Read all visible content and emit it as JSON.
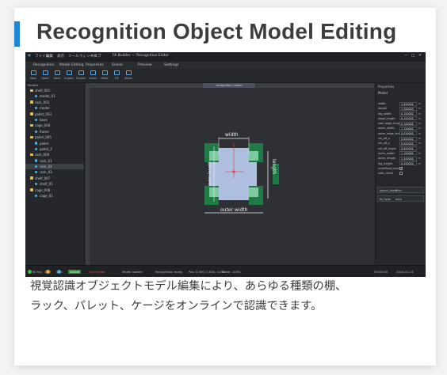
{
  "card": {
    "title": "Recognition Object Model Editing",
    "caption_line1": "視覚認識オブジェクトモデル編集により、あらゆる種類の棚、",
    "caption_line2": "ラック、パレット、ケージをオンラインで認識できます。",
    "accent_color": "#1d84d6"
  },
  "app": {
    "title_menus": [
      "ファイル",
      "編集",
      "表示",
      "ツール",
      "ウィンドウ",
      "ヘルプ"
    ],
    "window_title": "FA Builder — Recognition Editor",
    "window_controls": [
      "minimize-icon",
      "maximize-icon",
      "close-icon"
    ],
    "tabs": [
      "Recognition",
      "Model Editing",
      "Properties",
      "Scene",
      "Preview",
      "Settings"
    ],
    "toolbar": [
      "New",
      "Open",
      "Save",
      "Import",
      "Export",
      "Undo",
      "Redo",
      "Fit",
      "Zoom"
    ],
    "tree": {
      "header": "Models",
      "items": [
        {
          "type": "folder",
          "label": "shelf_001",
          "indent": 1
        },
        {
          "type": "item",
          "label": "model_01",
          "indent": 2
        },
        {
          "type": "folder",
          "label": "rack_002",
          "indent": 1
        },
        {
          "type": "item",
          "label": "model",
          "indent": 2
        },
        {
          "type": "folder",
          "label": "pallet_003",
          "indent": 1
        },
        {
          "type": "item",
          "label": "base",
          "indent": 2
        },
        {
          "type": "folder",
          "label": "cage_004",
          "indent": 1
        },
        {
          "type": "item",
          "label": "frame",
          "indent": 2
        },
        {
          "type": "folder",
          "label": "pallet_005",
          "indent": 1
        },
        {
          "type": "item",
          "label": "pallet",
          "indent": 2
        },
        {
          "type": "item",
          "label": "pallet_2",
          "indent": 2
        },
        {
          "type": "folder",
          "label": "rack_006",
          "indent": 1
        },
        {
          "type": "item",
          "label": "rack_01",
          "indent": 2
        },
        {
          "type": "item",
          "label": "rack_02",
          "indent": 2,
          "selected": true
        },
        {
          "type": "item",
          "label": "rack_03",
          "indent": 2
        },
        {
          "type": "folder",
          "label": "shelf_007",
          "indent": 1
        },
        {
          "type": "item",
          "label": "shelf_01",
          "indent": 2
        },
        {
          "type": "folder",
          "label": "cage_008",
          "indent": 1
        },
        {
          "type": "item",
          "label": "cage_01",
          "indent": 2
        }
      ]
    },
    "canvas": {
      "tab_label": "recognition_model",
      "labels": {
        "width": "width",
        "length": "length",
        "outer_width": "outer width",
        "outer_length": "outer length"
      },
      "colors": {
        "inner": "#aebfdf",
        "leg": "#1f7a45",
        "leg_inner": "#7ec9a0",
        "line": "#f0f0f0",
        "center": "#e03a3a"
      }
    },
    "properties": {
      "title": "Properties",
      "subtitle": "Model",
      "rows": [
        {
          "label": "width",
          "value": "1.000000",
          "unit": "m"
        },
        {
          "label": "length",
          "value": "1.200000",
          "unit": "m"
        },
        {
          "label": "leg_width",
          "value": "0.100000",
          "unit": "m"
        },
        {
          "label": "edge_length",
          "value": "0.100000",
          "unit": "m"
        },
        {
          "label": "side_edge_length",
          "value": "0.100000",
          "unit": "m"
        },
        {
          "label": "outer_width",
          "value": "1.100000",
          "unit": "m"
        },
        {
          "label": "outer_edge_length",
          "value": "0.050000",
          "unit": "m"
        },
        {
          "label": "rot_off_x",
          "value": "0.000000",
          "unit": "m"
        },
        {
          "label": "rot_off_y",
          "value": "0.000000",
          "unit": "m"
        },
        {
          "label": "rot_off_angle",
          "value": "0.000000",
          "unit": "°"
        },
        {
          "label": "outer_width",
          "value": "1.100000",
          "unit": "m"
        },
        {
          "label": "outer_length",
          "value": "1.300000",
          "unit": "m"
        },
        {
          "label": "leg_height",
          "value": "0.200000",
          "unit": "m"
        }
      ],
      "checks": [
        {
          "label": "undefined_check",
          "checked": true
        },
        {
          "label": "side_check",
          "checked": false
        }
      ],
      "dropdowns": [
        {
          "label": "object_direction",
          "value": "X"
        },
        {
          "label": "fix_type",
          "value": "auto"
        }
      ]
    },
    "status": {
      "left": [
        "80 fps",
        "CPU",
        "GPU"
      ],
      "badge": "Online",
      "messages": [
        "Connected",
        "Model loaded",
        "Recognition ready",
        "Pos: 0.000, 0.000, 0.000",
        "Scale: 100%"
      ],
      "right": [
        "00:00:00",
        "2024-01-01"
      ]
    }
  }
}
